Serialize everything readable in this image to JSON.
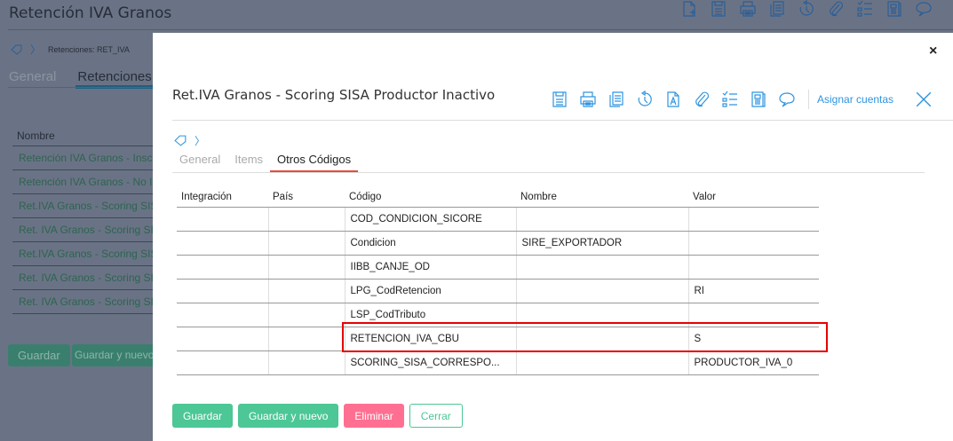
{
  "background": {
    "title": "Retención IVA Granos",
    "breadcrumb": "Retenciones: RET_IVA",
    "tabs": [
      "General",
      "Retenciones"
    ],
    "table_header": "Nombre",
    "rows": [
      "Retención IVA Granos - Inscr",
      "Retención IVA Granos - No In",
      "Ret.IVA Granos - Scoring SIS",
      "Ret. IVA Granos - Scoring SIS",
      "Ret.IVA Granos - Scoring SIS",
      "Ret. IVA Granos - Scoring SIS",
      "Ret. IVA Granos - Scoring SIS"
    ],
    "buttons": [
      "Guardar",
      "Guardar y nuevo"
    ],
    "icons": [
      "new-file-icon",
      "save-icon",
      "print-icon",
      "copy-icon",
      "history-icon",
      "attach-icon",
      "checklist-icon",
      "document-icon",
      "comment-icon"
    ]
  },
  "modal": {
    "close": "×",
    "title": "Ret.IVA Granos - Scoring SISA Productor Inactivo",
    "toolbar": {
      "icons": [
        "save-icon",
        "print-icon",
        "copy-icon",
        "history-icon",
        "text-file-icon",
        "attach-icon",
        "checklist-icon",
        "document-icon",
        "comment-icon"
      ],
      "asignar": "Asignar cuentas"
    },
    "tabs": [
      "General",
      "Items",
      "Otros Códigos"
    ],
    "active_tab": "Otros Códigos",
    "columns": [
      "Integración",
      "País",
      "Código",
      "Nombre",
      "Valor"
    ],
    "rows": [
      [
        "",
        "",
        "COD_CONDICION_SICORE",
        "",
        ""
      ],
      [
        "",
        "",
        "Condicion",
        "SIRE_EXPORTADOR",
        ""
      ],
      [
        "",
        "",
        "IIBB_CANJE_OD",
        "",
        ""
      ],
      [
        "",
        "",
        "LPG_CodRetencion",
        "",
        "RI"
      ],
      [
        "",
        "",
        "LSP_CodTributo",
        "",
        ""
      ],
      [
        "",
        "",
        "RETENCION_IVA_CBU",
        "",
        "S"
      ],
      [
        "",
        "",
        "SCORING_SISA_CORRESPO...",
        "",
        "PRODUCTOR_IVA_0"
      ]
    ],
    "highlighted_row": "RETENCION_IVA_CBU",
    "buttons": {
      "guardar": "Guardar",
      "guardar_nuevo": "Guardar y nuevo",
      "eliminar": "Eliminar",
      "cerrar": "Cerrar"
    }
  },
  "colors": {
    "accent": "#2f95e0",
    "green": "#4cc795",
    "danger": "#ff6f91",
    "highlight": "#e80000",
    "active_tab": "#e74c3c"
  }
}
